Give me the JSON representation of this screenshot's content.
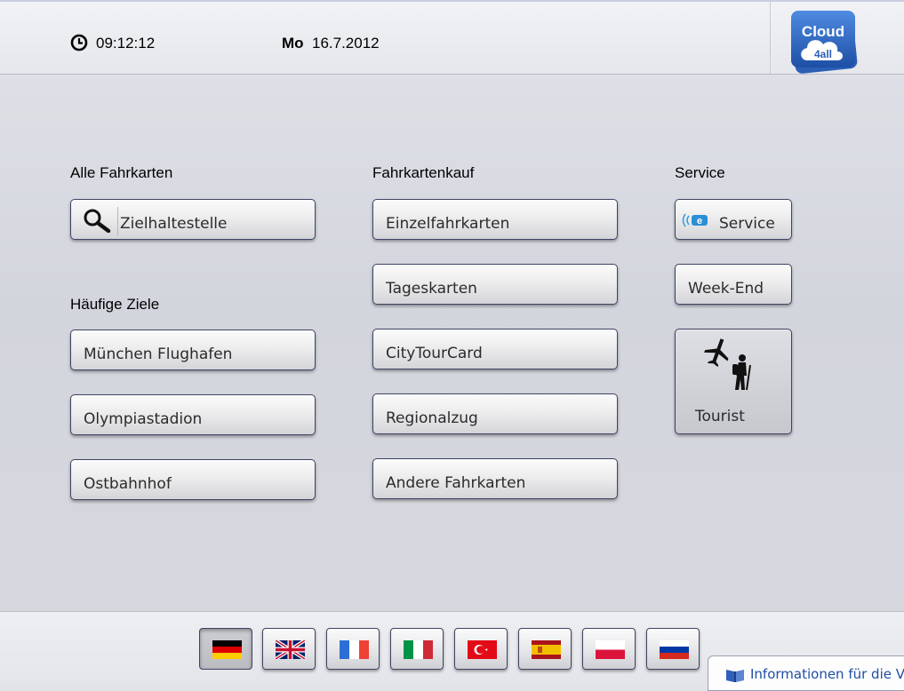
{
  "header": {
    "time": "09:12:12",
    "weekday": "Mo",
    "date": "16.7.2012",
    "logo": {
      "text1": "Cloud",
      "text2": "4all",
      "color": "#2a5fb8"
    }
  },
  "sections": {
    "alle_fahrkarten": {
      "title": "Alle Fahrkarten",
      "search_button": "Zielhaltestelle"
    },
    "haeufige_ziele": {
      "title": "Häufige Ziele",
      "items": [
        "München Flughafen",
        "Olympiastadion",
        "Ostbahnhof"
      ]
    },
    "fahrkartenkauf": {
      "title": "Fahrkartenkauf",
      "items": [
        "Einzelfahrkarten",
        "Tageskarten",
        "CityTourCard",
        "Regionalzug",
        "Andere Fahrkarten"
      ]
    },
    "service": {
      "title": "Service",
      "service_button": "Service",
      "weekend_button": "Week-End",
      "tourist_button": "Tourist"
    }
  },
  "languages": [
    {
      "name": "german-flag-icon",
      "active": true
    },
    {
      "name": "uk-flag-icon",
      "active": false
    },
    {
      "name": "france-flag-icon",
      "active": false
    },
    {
      "name": "italy-flag-icon",
      "active": false
    },
    {
      "name": "turkey-flag-icon",
      "active": false
    },
    {
      "name": "spain-flag-icon",
      "active": false
    },
    {
      "name": "poland-flag-icon",
      "active": false
    },
    {
      "name": "russia-flag-icon",
      "active": false
    }
  ],
  "footer": {
    "info_text": "Informationen für die Ver"
  },
  "colors": {
    "button_border": "#3d4363",
    "link_blue": "#1f4ea3"
  }
}
